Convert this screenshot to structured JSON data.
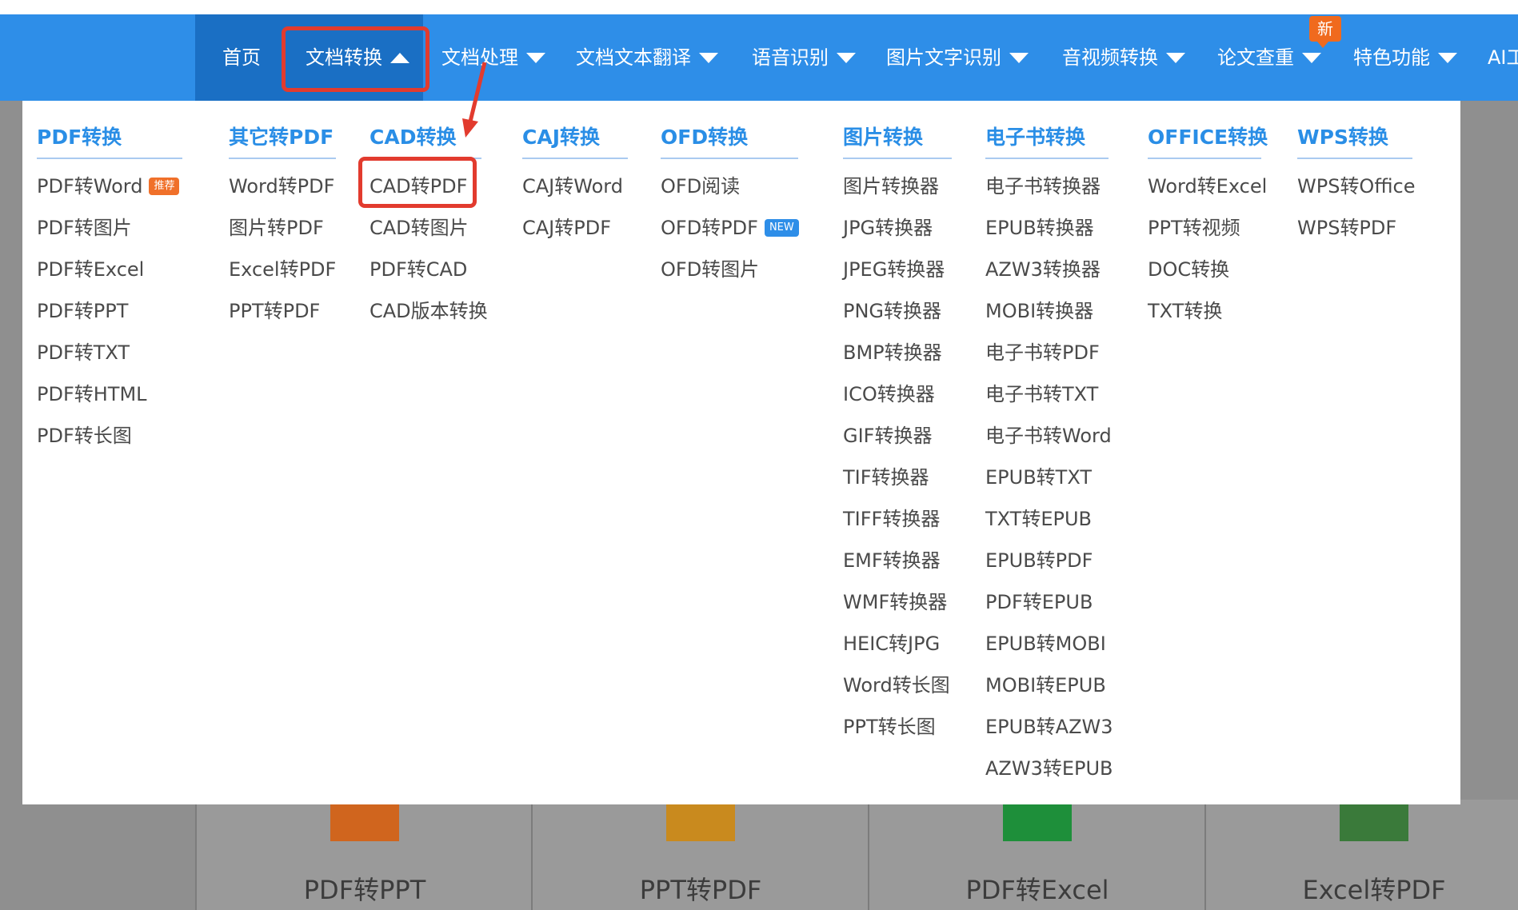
{
  "nav": {
    "items": [
      {
        "label": "首页",
        "caret": ""
      },
      {
        "label": "文档转换",
        "caret": "up"
      },
      {
        "label": "文档处理",
        "caret": "down"
      },
      {
        "label": "文档文本翻译",
        "caret": "down"
      },
      {
        "label": "语音识别",
        "caret": "down"
      },
      {
        "label": "图片文字识别",
        "caret": "down"
      },
      {
        "label": "音视频转换",
        "caret": "down"
      },
      {
        "label": "论文查重",
        "caret": "down"
      },
      {
        "label": "特色功能",
        "caret": "down"
      },
      {
        "label": "AI工",
        "caret": ""
      }
    ],
    "new_badge": "新"
  },
  "menu": {
    "columns": [
      {
        "title": "PDF转换",
        "items": [
          "PDF转Word",
          "PDF转图片",
          "PDF转Excel",
          "PDF转PPT",
          "PDF转TXT",
          "PDF转HTML",
          "PDF转长图"
        ],
        "badge_text": "推荐"
      },
      {
        "title": "其它转PDF",
        "items": [
          "Word转PDF",
          "图片转PDF",
          "Excel转PDF",
          "PPT转PDF"
        ]
      },
      {
        "title": "CAD转换",
        "items": [
          "CAD转PDF",
          "CAD转图片",
          "PDF转CAD",
          "CAD版本转换"
        ]
      },
      {
        "title": "CAJ转换",
        "items": [
          "CAJ转Word",
          "CAJ转PDF"
        ]
      },
      {
        "title": "OFD转换",
        "items": [
          "OFD阅读",
          "OFD转PDF",
          "OFD转图片"
        ],
        "badge_text": "NEW"
      },
      {
        "title": "图片转换",
        "items": [
          "图片转换器",
          "JPG转换器",
          "JPEG转换器",
          "PNG转换器",
          "BMP转换器",
          "ICO转换器",
          "GIF转换器",
          "TIF转换器",
          "TIFF转换器",
          "EMF转换器",
          "WMF转换器",
          "HEIC转JPG",
          "Word转长图",
          "PPT转长图"
        ]
      },
      {
        "title": "电子书转换",
        "items": [
          "电子书转换器",
          "EPUB转换器",
          "AZW3转换器",
          "MOBI转换器",
          "电子书转PDF",
          "电子书转TXT",
          "电子书转Word",
          "EPUB转TXT",
          "TXT转EPUB",
          "EPUB转PDF",
          "PDF转EPUB",
          "EPUB转MOBI",
          "MOBI转EPUB",
          "EPUB转AZW3",
          "AZW3转EPUB"
        ]
      },
      {
        "title": "OFFICE转换",
        "items": [
          "Word转Excel",
          "PPT转视频",
          "DOC转换",
          "TXT转换"
        ]
      },
      {
        "title": "WPS转换",
        "items": [
          "WPS转Office",
          "WPS转PDF"
        ]
      }
    ]
  },
  "background_cards": [
    {
      "label": "PDF转PPT",
      "color": "#d0651e"
    },
    {
      "label": "PPT转PDF",
      "color": "#c98a1e"
    },
    {
      "label": "PDF转Excel",
      "color": "#1e8f3a"
    },
    {
      "label": "Excel转PDF",
      "color": "#3a7a3a"
    }
  ],
  "colors": {
    "nav_bg": "#2e8ee8",
    "highlight": "#e23b2e",
    "menu_title": "#2a8ee6"
  }
}
